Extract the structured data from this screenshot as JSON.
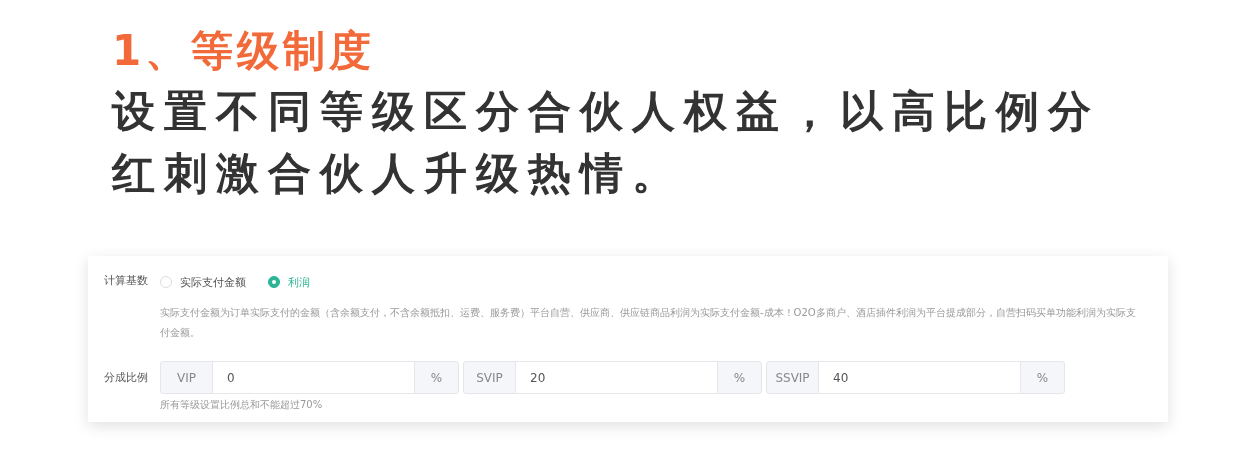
{
  "heading": "1、等级制度",
  "description_lines": [
    "设置不同等级区分合伙人权益，以高比例分",
    "红刺激合伙人升级热情。"
  ],
  "form": {
    "basis": {
      "label": "计算基数",
      "options": [
        {
          "label": "实际支付金额",
          "selected": false
        },
        {
          "label": "利润",
          "selected": true
        }
      ],
      "help": "实际支付金额为订单实际支付的金额（含余额支付，不含余额抵扣、运费、服务费）平台自营、供应商、供应链商品利润为实际支付金额-成本！O2O多商户、酒店插件利润为平台提成部分，自营扫码买单功能利润为实际支付金额。"
    },
    "ratio": {
      "label": "分成比例",
      "groups": [
        {
          "prefix": "VIP",
          "value": "0",
          "suffix": "%"
        },
        {
          "prefix": "SVIP",
          "value": "20",
          "suffix": "%"
        },
        {
          "prefix": "SSVIP",
          "value": "40",
          "suffix": "%"
        }
      ],
      "note": "所有等级设置比例总和不能超过70%"
    }
  }
}
